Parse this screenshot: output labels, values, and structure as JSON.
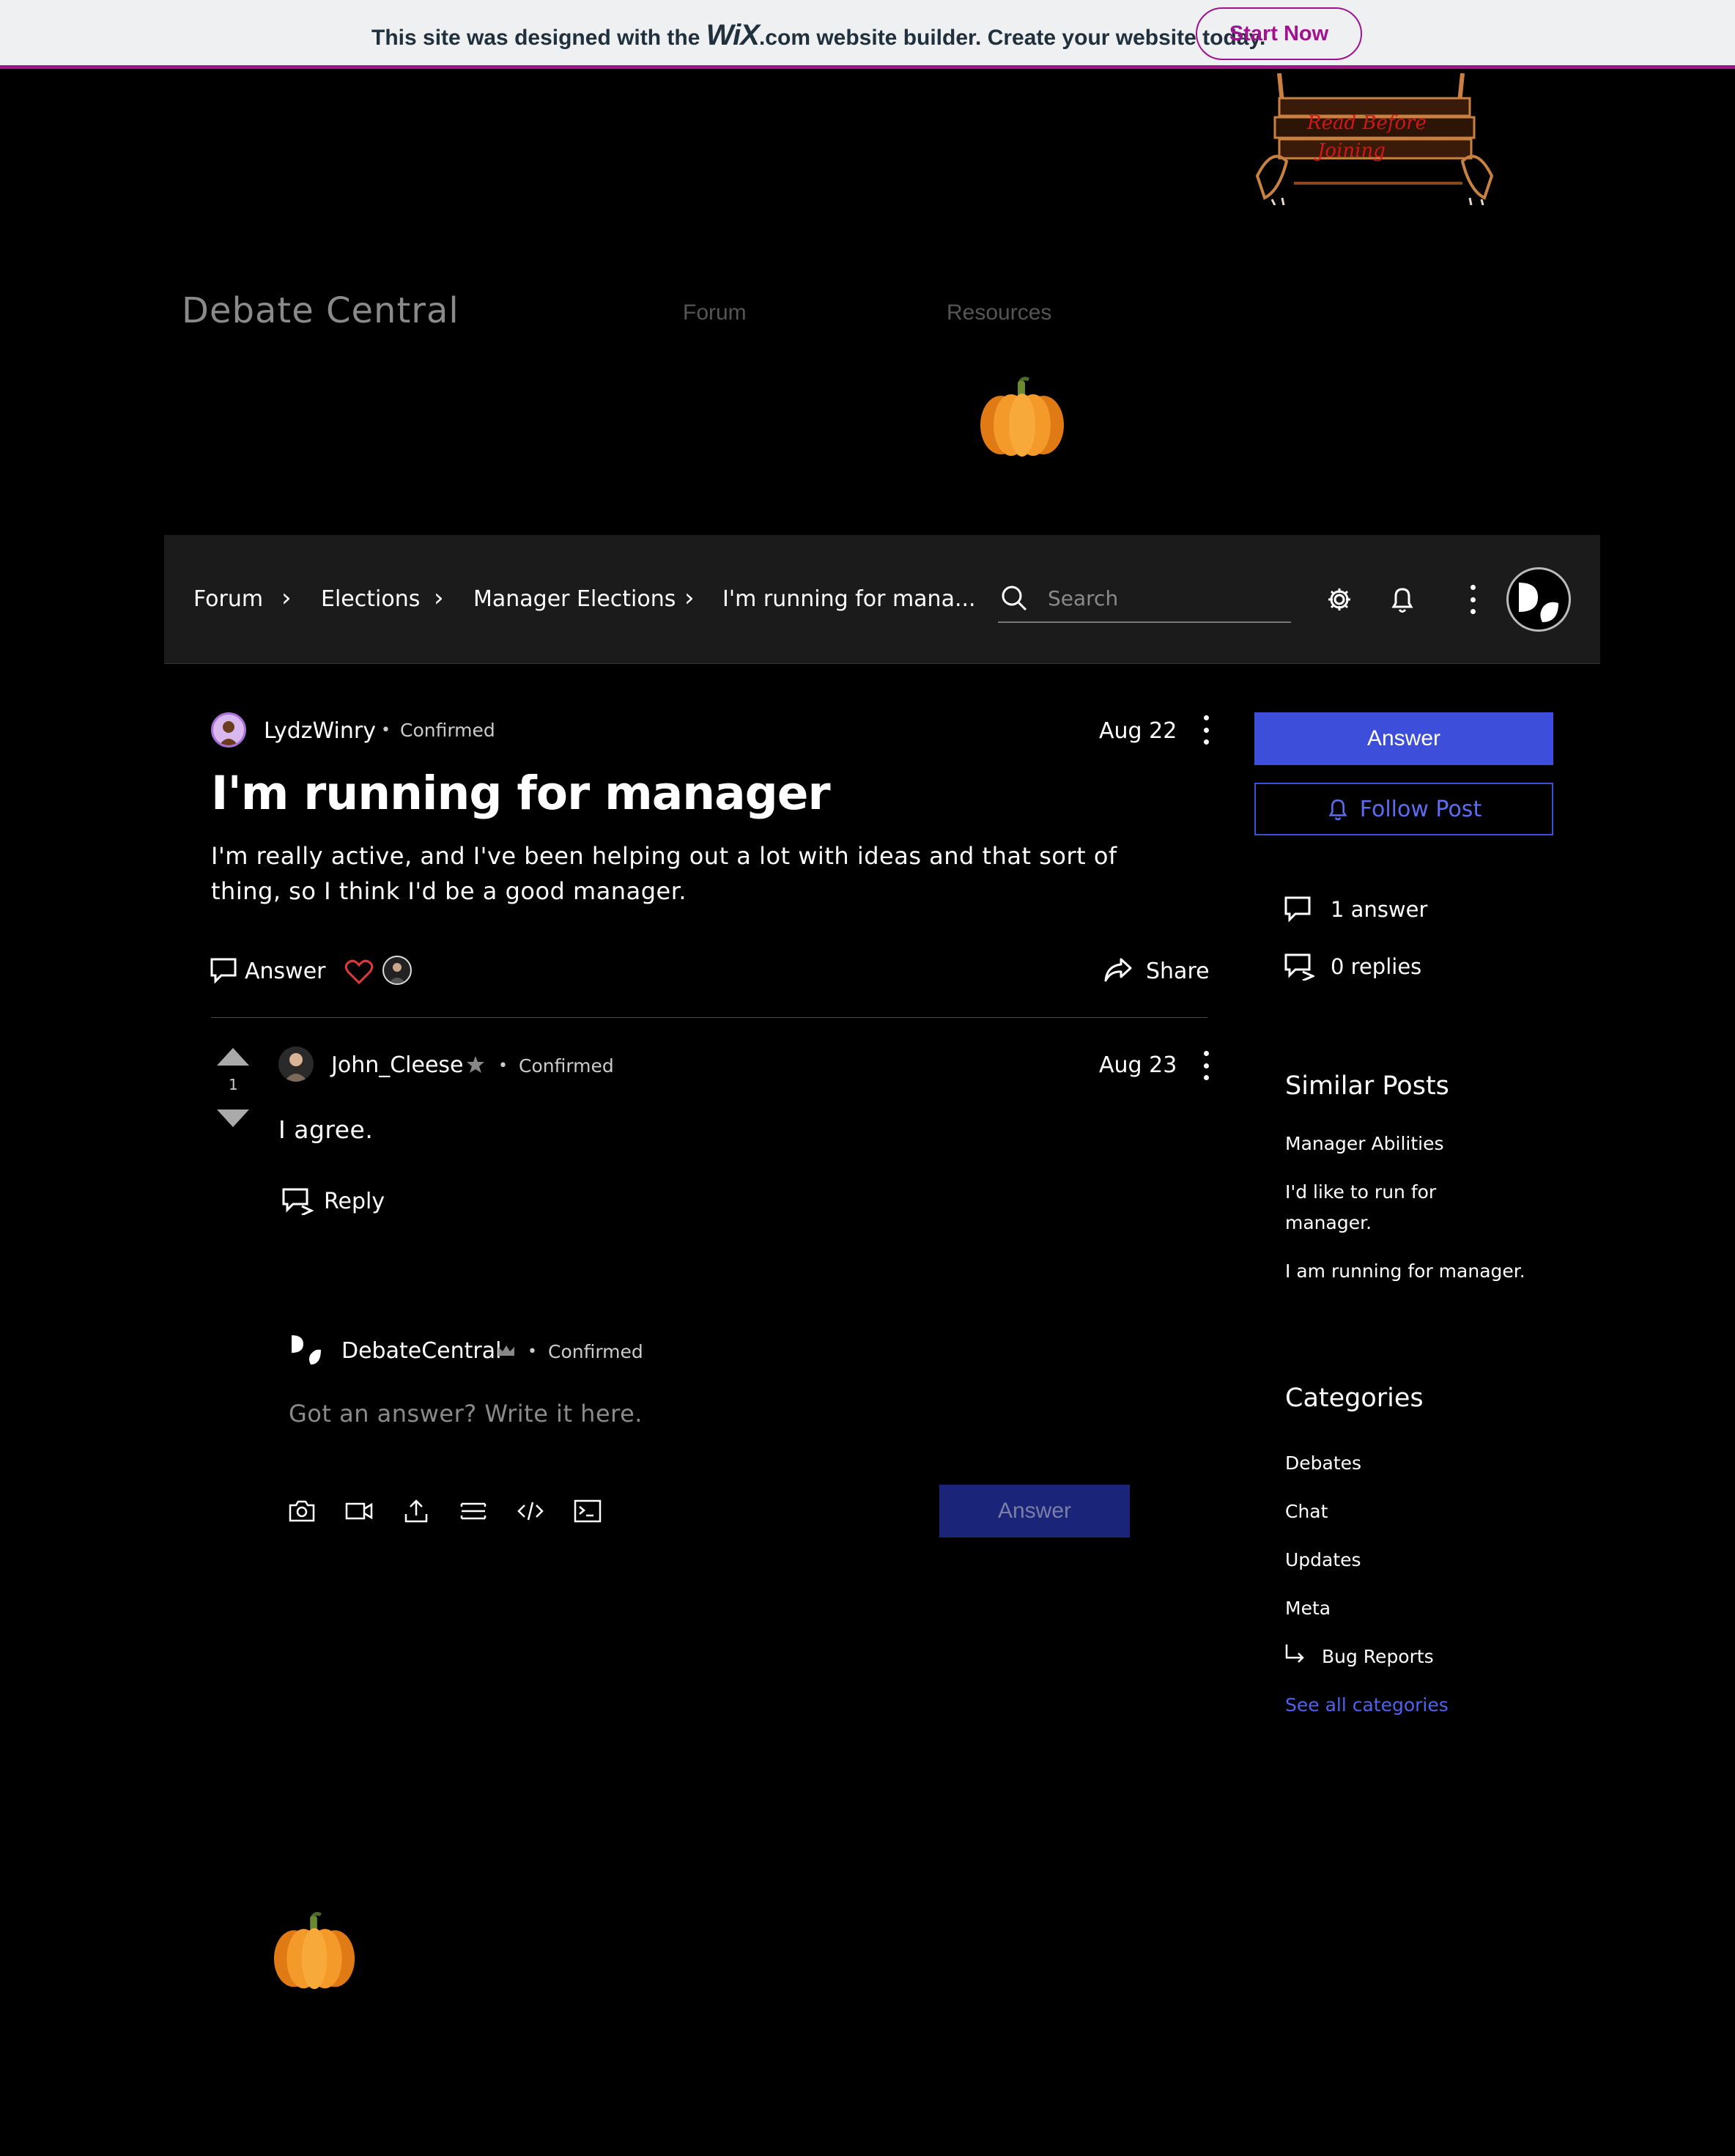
{
  "wix_banner": {
    "text_before": "This site was designed with the ",
    "logo": "WiX",
    "text_after": ".com website builder. Create your website today.",
    "cta": "Start Now",
    "accent": "#a0138e"
  },
  "header": {
    "sign_text_1": "Read Before",
    "sign_text_2": "Joining",
    "site_title": "Debate Central",
    "nav": [
      "Forum",
      "Resources"
    ]
  },
  "forum_bar": {
    "breadcrumbs": [
      "Forum",
      "Elections",
      "Manager Elections",
      "I'm running for mana..."
    ],
    "separator": "›",
    "search_placeholder": "Search",
    "icons": [
      "search-icon",
      "gear-icon",
      "bell-icon",
      "more-icon"
    ]
  },
  "post": {
    "author": "LydzWinry",
    "status": "Confirmed",
    "date": "Aug 22",
    "title": "I'm running for manager",
    "body": "I'm really active, and I've been helping out a lot with ideas and that sort of thing, so I think I'd be a good manager.",
    "answer_label": "Answer",
    "share_label": "Share"
  },
  "sidebar": {
    "answer_button": "Answer",
    "follow_button": "Follow Post",
    "answers_stat": "1 answer",
    "replies_stat": "0 replies",
    "similar_heading": "Similar Posts",
    "similar_posts": [
      "Manager Abilities",
      "I'd like to run for manager.",
      "I am running for manager."
    ],
    "categories_heading": "Categories",
    "categories": [
      "Debates",
      "Chat",
      "Updates",
      "Meta"
    ],
    "subcategory": "Bug Reports",
    "see_all": "See all categories",
    "accent": "#3d4edb"
  },
  "comment": {
    "author": "John_Cleese",
    "status": "Confirmed",
    "date": "Aug 23",
    "votes": "1",
    "text": "I agree.",
    "reply_label": "Reply"
  },
  "editor": {
    "author": "DebateCentral",
    "status": "Confirmed",
    "placeholder": "Got an answer? Write it here.",
    "submit_label": "Answer",
    "tools": [
      "camera-icon",
      "video-icon",
      "upload-icon",
      "divider-icon",
      "code-icon",
      "terminal-icon"
    ]
  }
}
